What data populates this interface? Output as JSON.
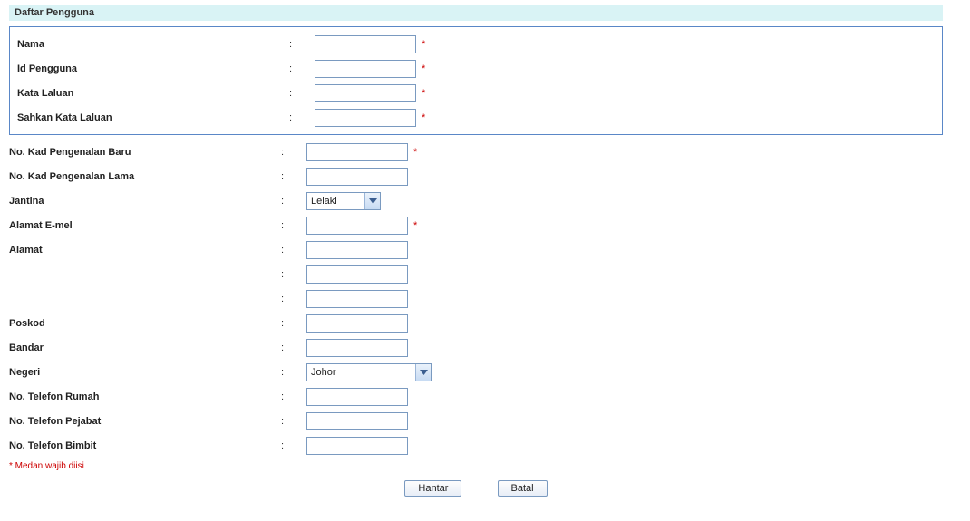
{
  "header": {
    "title": "Daftar Pengguna"
  },
  "fields": {
    "nama": {
      "label": "Nama",
      "value": "",
      "required": true
    },
    "id_pengguna": {
      "label": "Id Pengguna",
      "value": "",
      "required": true
    },
    "kata_laluan": {
      "label": "Kata Laluan",
      "value": "",
      "required": true
    },
    "sahkan_kata_laluan": {
      "label": "Sahkan Kata Laluan",
      "value": "",
      "required": true
    },
    "kp_baru": {
      "label": "No. Kad Pengenalan Baru",
      "value": "",
      "required": true
    },
    "kp_lama": {
      "label": "No. Kad Pengenalan Lama",
      "value": ""
    },
    "jantina": {
      "label": "Jantina",
      "selected": "Lelaki"
    },
    "emel": {
      "label": "Alamat E-mel",
      "value": "",
      "required": true
    },
    "alamat": {
      "label": "Alamat",
      "line1": "",
      "line2": "",
      "line3": ""
    },
    "poskod": {
      "label": "Poskod",
      "value": ""
    },
    "bandar": {
      "label": "Bandar",
      "value": ""
    },
    "negeri": {
      "label": "Negeri",
      "selected": "Johor"
    },
    "tel_rumah": {
      "label": "No. Telefon Rumah",
      "value": ""
    },
    "tel_pejabat": {
      "label": "No. Telefon Pejabat",
      "value": ""
    },
    "tel_bimbit": {
      "label": "No. Telefon Bimbit",
      "value": ""
    }
  },
  "required_marker": "*",
  "note": "* Medan wajib diisi",
  "buttons": {
    "submit": "Hantar",
    "cancel": "Batal"
  }
}
